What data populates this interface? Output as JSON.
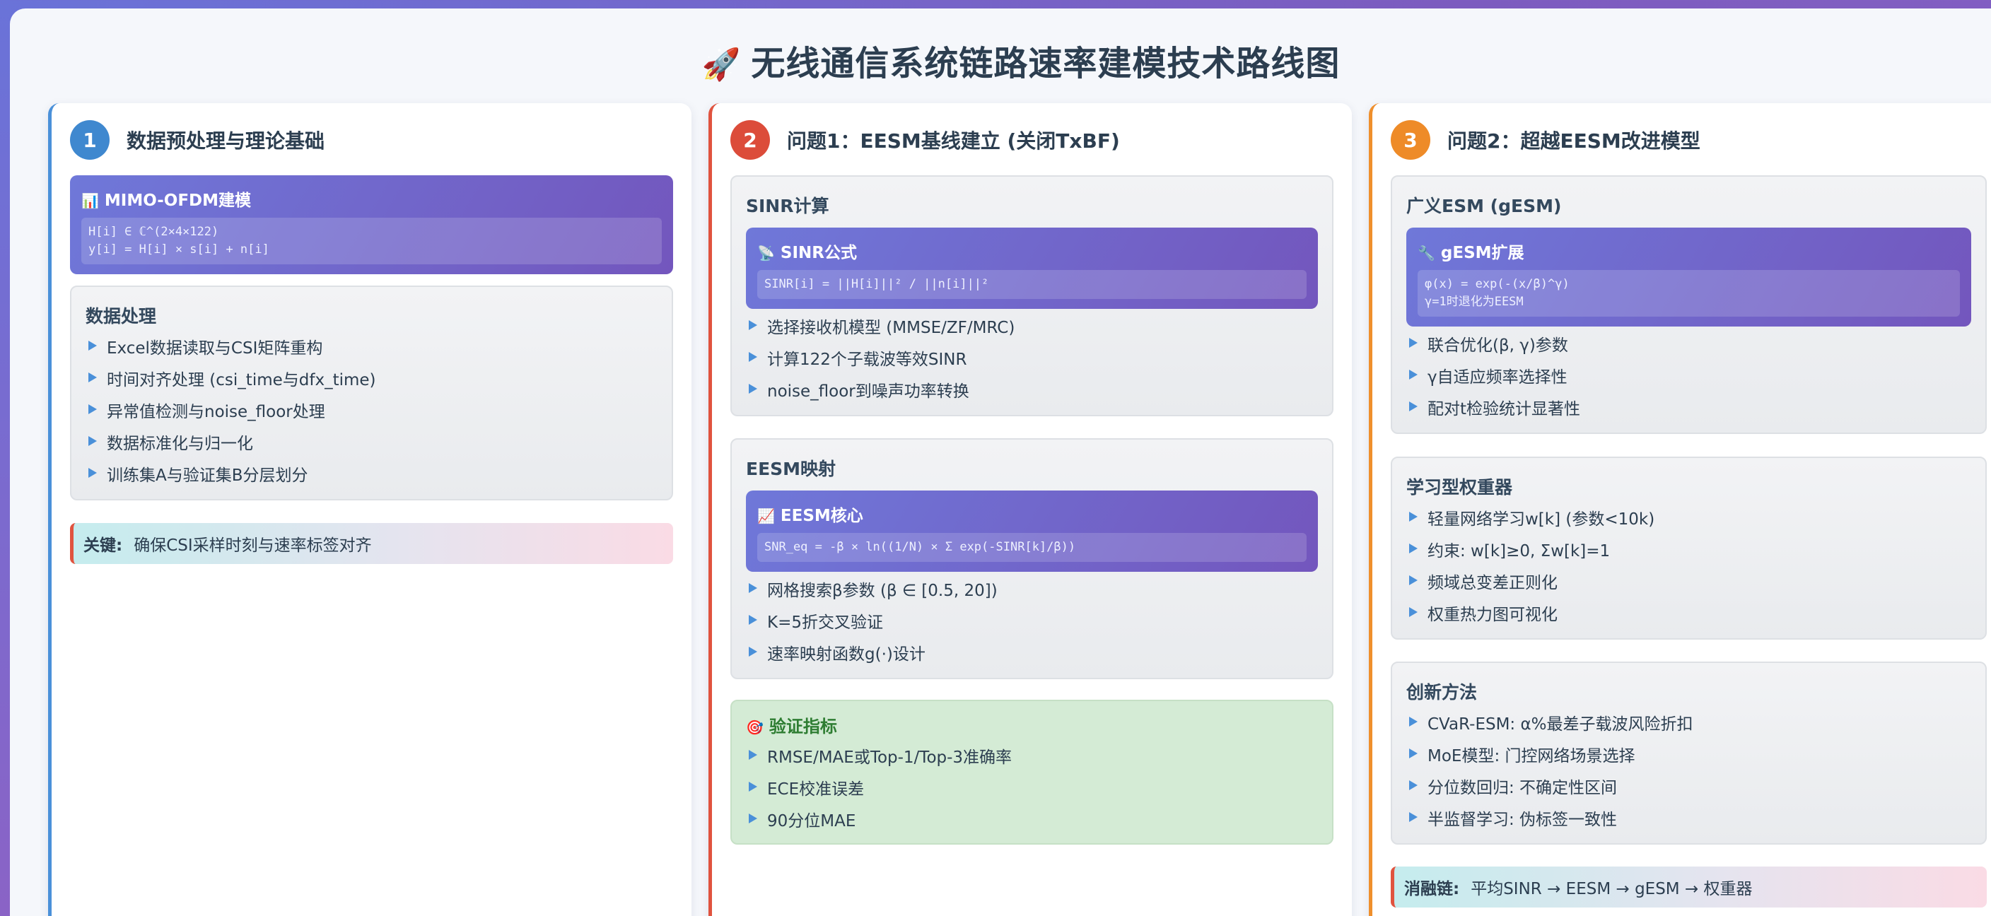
{
  "title": "无线通信系统链路速率建模技术路线图",
  "icons": {
    "title": "rocket-icon",
    "chart": "bar-chart-icon",
    "satellite": "satellite-dish-icon",
    "trend": "trend-chart-icon",
    "wrench": "wrench-icon",
    "target": "target-icon"
  },
  "colors": {
    "col1": "#4a90d9",
    "col2": "#e0533f",
    "col3": "#ef8f2c",
    "formula_bg": "#7356bd",
    "verify_bg": "#d4ebd5"
  },
  "col1": {
    "num": "1",
    "title": "数据预处理与理论基础",
    "formula": {
      "title": "MIMO-OFDM建模",
      "code": "H[i] ∈ ℂ^(2×4×122)\ny[i] = H[i] × s[i] + n[i]"
    },
    "section": {
      "title": "数据处理",
      "items": [
        "Excel数据读取与CSI矩阵重构",
        "时间对齐处理 (csi_time与dfx_time)",
        "异常值检测与noise_floor处理",
        "数据标准化与归一化",
        "训练集A与验证集B分层划分"
      ]
    },
    "key": {
      "label": "关键:",
      "text": "确保CSI采样时刻与速率标签对齐"
    }
  },
  "col2": {
    "num": "2",
    "title": "问题1：EESM基线建立 (关闭TxBF)",
    "sinr": {
      "title": "SINR计算",
      "formula_title": "SINR公式",
      "code": "SINR[i] = ||H[i]||² / ||n[i]||²",
      "items": [
        "选择接收机模型 (MMSE/ZF/MRC)",
        "计算122个子载波等效SINR",
        "noise_floor到噪声功率转换"
      ]
    },
    "eesm": {
      "title": "EESM映射",
      "formula_title": "EESM核心",
      "code": "SNR_eq = -β × ln((1/N) × Σ exp(-SINR[k]/β))",
      "items": [
        "网格搜索β参数 (β ∈ [0.5, 20])",
        "K=5折交叉验证",
        "速率映射函数g(·)设计"
      ]
    },
    "verify": {
      "title": "验证指标",
      "items": [
        "RMSE/MAE或Top-1/Top-3准确率",
        "ECE校准误差",
        "90分位MAE"
      ]
    }
  },
  "col3": {
    "num": "3",
    "title": "问题2：超越EESM改进模型",
    "gesm": {
      "title": "广义ESM (gESM)",
      "formula_title": "gESM扩展",
      "code": "φ(x) = exp(-(x/β)^γ)\nγ=1时退化为EESM",
      "items": [
        "联合优化(β, γ)参数",
        "γ自适应频率选择性",
        "配对t检验统计显著性"
      ]
    },
    "weight": {
      "title": "学习型权重器",
      "items": [
        "轻量网络学习w[k] (参数<10k)",
        "约束: w[k]≥0, Σw[k]=1",
        "频域总变差正则化",
        "权重热力图可视化"
      ]
    },
    "innov": {
      "title": "创新方法",
      "items": [
        "CVaR-ESM: α%最差子载波风险折扣",
        "MoE模型: 门控网络场景选择",
        "分位数回归: 不确定性区间",
        "半监督学习: 伪标签一致性"
      ]
    },
    "ablation": {
      "label": "消融链:",
      "text": "平均SINR → EESM → gESM → 权重器"
    }
  }
}
